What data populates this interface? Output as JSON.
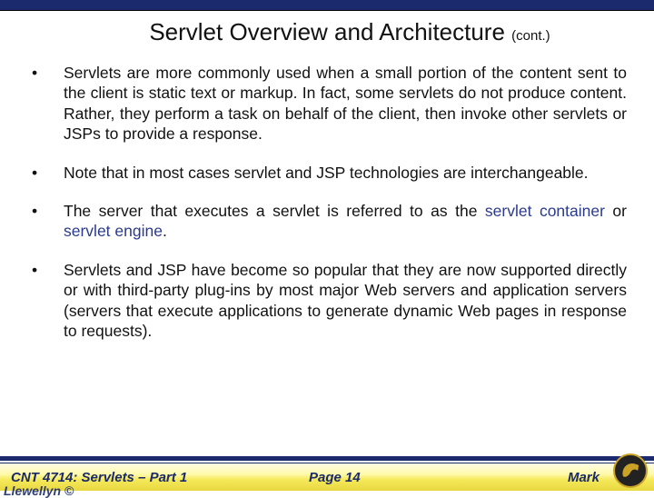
{
  "title": {
    "main": "Servlet Overview and Architecture ",
    "suffix": "(cont.)"
  },
  "bullets": [
    {
      "segments": [
        {
          "text": "Servlets are more commonly used when a small portion of the content sent to the client is static text or markup.  In fact, some servlets do not produce content. Rather, they perform a task on behalf of the client, then invoke other servlets or JSPs to provide a response.",
          "term": false
        }
      ]
    },
    {
      "segments": [
        {
          "text": "Note that in most cases servlet and JSP technologies are interchangeable.",
          "term": false
        }
      ]
    },
    {
      "segments": [
        {
          "text": "The server that executes a servlet is referred to as the ",
          "term": false
        },
        {
          "text": "servlet container",
          "term": true
        },
        {
          "text": " or ",
          "term": false
        },
        {
          "text": "servlet engine",
          "term": true
        },
        {
          "text": ".",
          "term": false
        }
      ]
    },
    {
      "segments": [
        {
          "text": "Servlets and JSP have become so popular that they are now supported directly or with third-party plug-ins by most major Web servers and application servers (servers that execute applications to generate dynamic Web pages in response to requests).",
          "term": false
        }
      ]
    }
  ],
  "footer": {
    "left": "CNT 4714: Servlets – Part 1",
    "center": "Page 14",
    "right": "Mark",
    "cutoff": "Llewellyn ©"
  }
}
